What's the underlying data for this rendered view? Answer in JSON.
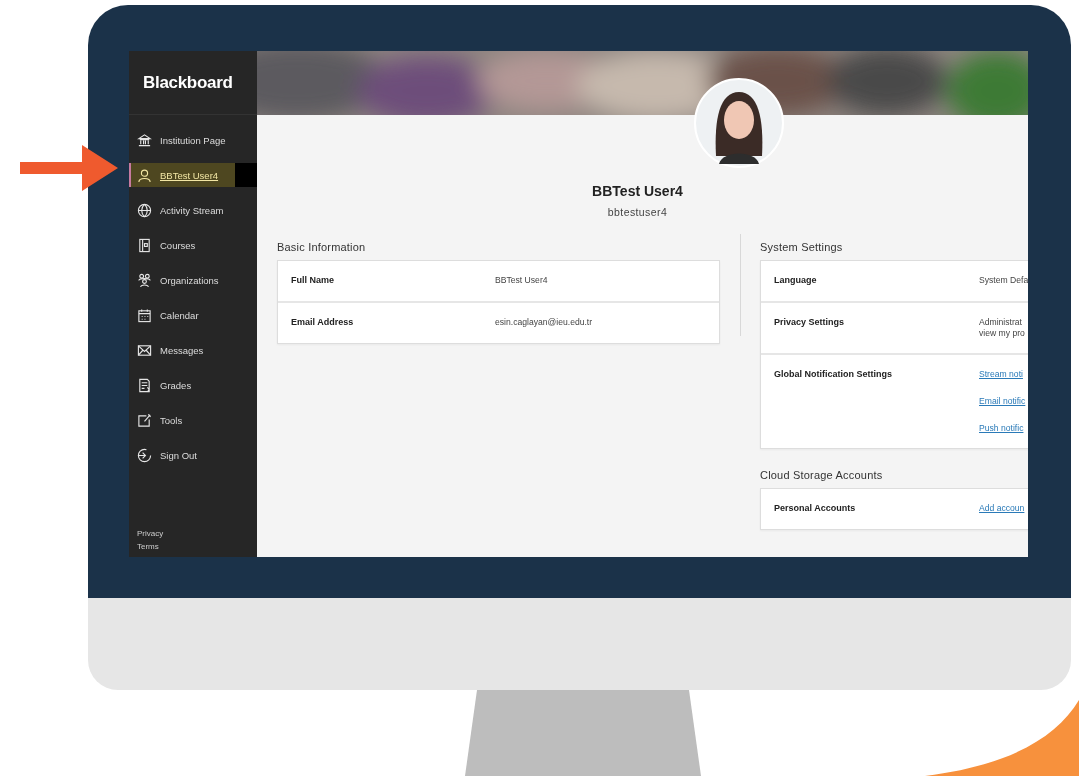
{
  "sidebar": {
    "logo": "Blackboard",
    "items": [
      {
        "label": "Institution Page",
        "selected": false
      },
      {
        "label": "BBTest User4",
        "selected": true
      },
      {
        "label": "Activity Stream",
        "selected": false
      },
      {
        "label": "Courses",
        "selected": false
      },
      {
        "label": "Organizations",
        "selected": false
      },
      {
        "label": "Calendar",
        "selected": false
      },
      {
        "label": "Messages",
        "selected": false
      },
      {
        "label": "Grades",
        "selected": false
      },
      {
        "label": "Tools",
        "selected": false
      },
      {
        "label": "Sign Out",
        "selected": false
      }
    ],
    "footer_links": [
      "Privacy",
      "Terms"
    ]
  },
  "profile": {
    "name": "BBTest User4",
    "username": "bbtestuser4"
  },
  "left_sections": [
    {
      "title": "Basic Information",
      "rows": [
        {
          "label": "Full Name",
          "values": [
            {
              "kind": "text",
              "text": "BBTest User4"
            }
          ]
        },
        {
          "label": "Email Address",
          "values": [
            {
              "kind": "text",
              "text": "esin.caglayan@ieu.edu.tr"
            }
          ]
        }
      ]
    }
  ],
  "right_sections": [
    {
      "title": "System Settings",
      "rows": [
        {
          "label": "Language",
          "values": [
            {
              "kind": "text",
              "text": "System Defa"
            }
          ]
        },
        {
          "label": "Privacy Settings",
          "values": [
            {
              "kind": "text",
              "text": "Administrat"
            },
            {
              "kind": "text",
              "text": "view my pro"
            }
          ]
        },
        {
          "label": "Global Notification Settings",
          "values": [
            {
              "kind": "link",
              "text": "Stream noti"
            },
            {
              "kind": "link",
              "text": "Email notific"
            },
            {
              "kind": "link",
              "text": "Push notific"
            }
          ]
        }
      ]
    },
    {
      "title": "Cloud Storage Accounts",
      "rows": [
        {
          "label": "Personal Accounts",
          "values": [
            {
              "kind": "link",
              "text": "Add accoun"
            }
          ]
        }
      ]
    }
  ]
}
